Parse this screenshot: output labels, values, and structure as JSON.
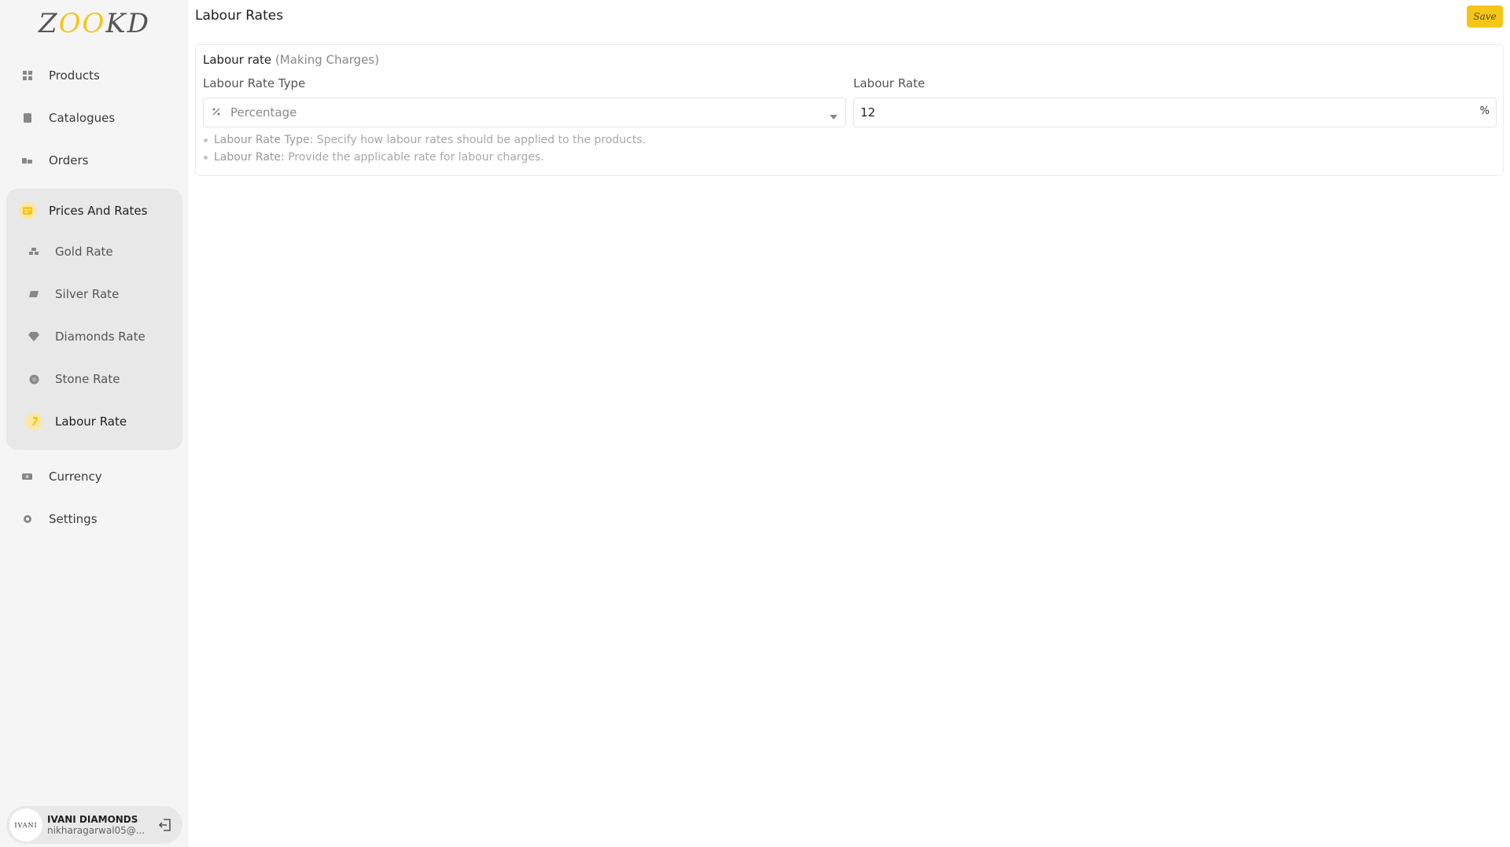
{
  "logo": {
    "part1": "Z",
    "part2": "OO",
    "part3": "KD"
  },
  "nav": {
    "products": "Products",
    "catalogues": "Catalogues",
    "orders": "Orders",
    "prices_and_rates": "Prices And Rates",
    "gold_rate": "Gold Rate",
    "silver_rate": "Silver Rate",
    "diamonds_rate": "Diamonds Rate",
    "stone_rate": "Stone Rate",
    "labour_rate": "Labour Rate",
    "currency": "Currency",
    "settings": "Settings"
  },
  "user": {
    "avatar_text": "IVANI",
    "name": "IVANI DIAMONDS",
    "email": "nikharagarwal05@..."
  },
  "header": {
    "title": "Labour Rates",
    "save_label": "Save"
  },
  "card": {
    "title": "Labour rate",
    "title_suffix": "(Making Charges)",
    "type_label": "Labour Rate Type",
    "type_value": "Percentage",
    "rate_label": "Labour Rate",
    "rate_value": "12",
    "rate_unit": "%",
    "help": [
      {
        "key": "Labour Rate Type:",
        "text": "Specify how labour rates should be applied to the products."
      },
      {
        "key": "Labour Rate:",
        "text": "Provide the applicable rate for labour charges."
      }
    ]
  },
  "colors": {
    "accent": "#f5c518",
    "accent_soft": "#fbe7a1",
    "sidebar_bg": "#f5f5f5",
    "group_bg": "#e8e8e8"
  }
}
